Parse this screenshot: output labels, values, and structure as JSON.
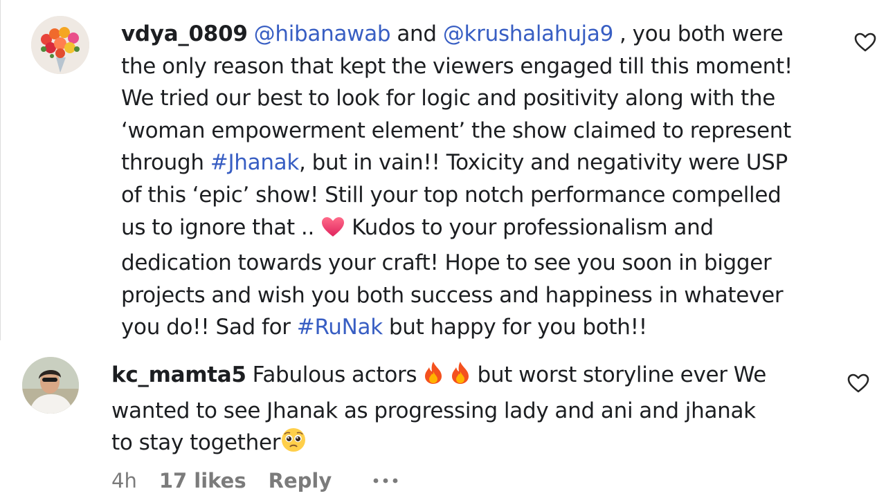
{
  "comments": [
    {
      "username": "vdya_0809",
      "lines": [
        [
          {
            "type": "text",
            "text": " "
          },
          {
            "type": "mention",
            "text": "@hibanawab"
          },
          {
            "type": "text",
            "text": " and "
          },
          {
            "type": "mention",
            "text": "@krushalahuja9"
          },
          {
            "type": "text",
            "text": " , you both were"
          }
        ],
        [
          {
            "type": "text",
            "text": "the only reason that kept the viewers engaged till this moment!"
          }
        ],
        [
          {
            "type": "text",
            "text": "We tried our best to look for logic and positivity along with the"
          }
        ],
        [
          {
            "type": "text",
            "text": "‘woman empowerment element’ the show claimed to represent"
          }
        ],
        [
          {
            "type": "text",
            "text": "through "
          },
          {
            "type": "hashtag",
            "text": "#Jhanak"
          },
          {
            "type": "text",
            "text": ", but in vain!! Toxicity and negativity were USP"
          }
        ],
        [
          {
            "type": "text",
            "text": "of this ‘epic’ show! Still your top notch performance compelled"
          }
        ],
        [
          {
            "type": "text",
            "text": "us to ignore that .. "
          },
          {
            "type": "emoji",
            "name": "heart-emoji"
          },
          {
            "type": "text",
            "text": " Kudos to your professionalism and"
          }
        ],
        [
          {
            "type": "text",
            "text": "dedication towards your craft! Hope to see you soon in bigger"
          }
        ],
        [
          {
            "type": "text",
            "text": "projects and wish you both success and happiness in whatever"
          }
        ],
        [
          {
            "type": "text",
            "text": "you do!! Sad for "
          },
          {
            "type": "hashtag",
            "text": "#RuNak"
          },
          {
            "type": "text",
            "text": " but happy for you both!!"
          }
        ]
      ]
    },
    {
      "username": "kc_mamta5",
      "lines": [
        [
          {
            "type": "text",
            "text": " Fabulous actors "
          },
          {
            "type": "emoji",
            "name": "fire-emoji"
          },
          {
            "type": "text",
            "text": " "
          },
          {
            "type": "emoji",
            "name": "fire-emoji"
          },
          {
            "type": "text",
            "text": " but worst storyline ever We"
          }
        ],
        [
          {
            "type": "text",
            "text": "wanted to see Jhanak as progressing lady and ani and jhanak"
          }
        ],
        [
          {
            "type": "text",
            "text": "to stay together"
          },
          {
            "type": "emoji",
            "name": "pleading-face-emoji"
          }
        ]
      ],
      "time": "4h",
      "likes": "17 likes",
      "reply_label": "Reply"
    }
  ],
  "icons": {
    "like": "heart-outline-icon",
    "more": "more-options-icon"
  },
  "colors": {
    "text": "#1c1e21",
    "link": "#385ec3",
    "meta": "#7b7b7b"
  }
}
